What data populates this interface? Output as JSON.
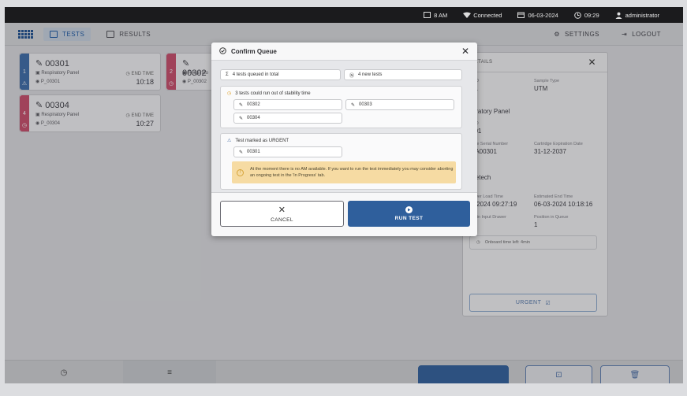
{
  "status_bar": {
    "drawer": "8 AM",
    "connection": "Connected",
    "date": "06-03-2024",
    "time": "09:29",
    "user": "administrator"
  },
  "app_bar": {
    "tabs": [
      {
        "label": "TESTS",
        "active": true
      },
      {
        "label": "RESULTS",
        "active": false
      }
    ],
    "settings_label": "SETTINGS",
    "logout_label": "LOGOUT"
  },
  "cards": [
    {
      "id": "00301",
      "position": "1",
      "panel": "Respiratory Panel",
      "pid": "P_00301",
      "end_label": "END TIME",
      "end_time": "10:18",
      "color": "#3b6ba8"
    },
    {
      "id": "00302",
      "position": "2",
      "panel": "Respirato",
      "pid": "P_00302",
      "color": "#c94b6a"
    },
    {
      "id": "00304",
      "position": "4",
      "panel": "Respiratory Panel",
      "pid": "P_00304",
      "end_label": "END TIME",
      "end_time": "10:27",
      "color": "#c94b6a"
    }
  ],
  "details": {
    "header": "DETAILS",
    "sample_id_label": "e ID",
    "sample_id_value": "31",
    "sample_type_label": "Sample Type",
    "sample_type_value": "UTM",
    "assay_value": "piratory Panel",
    "pid_label": "c ID",
    "pid_value": "301",
    "cartridge_serial_label": "idge Serial Number",
    "cartridge_serial_value": "AA00301",
    "cartridge_exp_label": "Cartridge Expiration Date",
    "cartridge_exp_value": "31-12-2037",
    "operator_label": "tor",
    "operator_value": "icetech",
    "load_time_label": "rawer Load Time",
    "load_time_value": "3-2024 09:27:19",
    "est_end_label": "Estimated End Time",
    "est_end_value": "06-03-2024 10:18:16",
    "input_pos_label": "on in Input Drawer",
    "queue_pos_label": "Position in Queue",
    "queue_pos_value": "1",
    "onboard_text": "Onboard time left: 4min",
    "urgent_label": "URGENT"
  },
  "modal": {
    "title": "Confirm Queue",
    "queued_text": "4 tests queued in total",
    "new_tests_text": "4 new tests",
    "stability_title": "3 tests could run out of stability time",
    "stability_tests": [
      "00302",
      "00303",
      "00304"
    ],
    "urgent_title": "Test marked as URGENT",
    "urgent_test": "00301",
    "warning_text": "At the moment there is no AM available. If you want to run the test immediately you may consider aborting an ongoing test in the 'In Progress' tab.",
    "cancel_label": "CANCEL",
    "run_label": "RUN TEST"
  },
  "colors": {
    "accent": "#2f5f9c",
    "warning_bg": "#f6dba3",
    "status_bar": "#1b1b1d"
  }
}
